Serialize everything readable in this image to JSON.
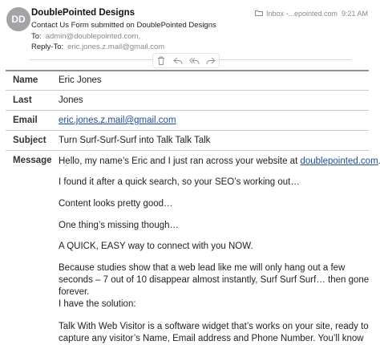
{
  "header": {
    "avatar_initials": "DD",
    "sender": "DoublePointed Designs",
    "subject": "Contact Us Form submitted on DoublePointed Designs",
    "to_label": "To:",
    "to_value": "admin@doublepointed.com,",
    "reply_to_label": "Reply-To:",
    "reply_to_value": "eric.jones.z.mail@gmail.com",
    "mailbox": "Inbox -...epointed.com",
    "time": "9:21 AM"
  },
  "toolbar": {
    "icons": [
      "trash-icon",
      "reply-icon",
      "reply-all-icon",
      "forward-icon"
    ]
  },
  "form": {
    "name_label": "Name",
    "name_value": "Eric Jones",
    "last_label": "Last",
    "last_value": "Jones",
    "email_label": "Email",
    "email_value": "eric.jones.z.mail@gmail.com",
    "subject_label": "Subject",
    "subject_value": "Turn Surf-Surf-Surf into Talk Talk Talk",
    "message_label": "Message",
    "message": {
      "p1_prefix": "Hello, my name’s Eric and I just ran across your website at ",
      "p1_link": "doublepointed.com",
      "p1_suffix": "...",
      "p2": "I found it after a quick search, so your SEO’s working out…",
      "p3": "Content looks pretty good…",
      "p4": "One thing’s missing though…",
      "p5": "A QUICK, EASY way to connect with you NOW.",
      "p6": "Because studies show that a web lead like me will only hang out a few seconds – 7 out of 10 disappear almost instantly, Surf Surf Surf… then gone forever.",
      "p7": "I have the solution:",
      "p8": "Talk With Web Visitor is a software widget that’s works on your site, ready to capture any visitor’s Name, Email address and Phone Number. You’ll know"
    }
  },
  "colors": {
    "link": "#1a4f9c",
    "muted": "#8a8a8e",
    "avatar": "#a3a3a8"
  }
}
